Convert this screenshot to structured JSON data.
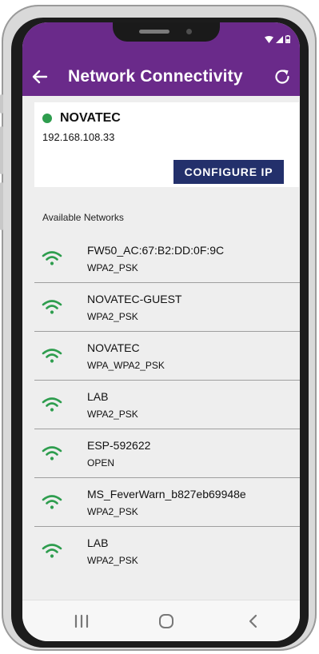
{
  "app_bar": {
    "title": "Network Connectivity",
    "back_icon": "arrow-left-icon",
    "refresh_icon": "refresh-icon",
    "background": "#6a2a8a"
  },
  "connected": {
    "ssid": "NOVATEC",
    "ip": "192.168.108.33",
    "status_color": "#2e9d4e",
    "configure_label": "CONFIGURE IP",
    "button_color": "#23306b"
  },
  "networks_label": "Available Networks",
  "networks": [
    {
      "ssid": "FW50_AC:67:B2:DD:0F:9C",
      "security": "WPA2_PSK"
    },
    {
      "ssid": "NOVATEC-GUEST",
      "security": "WPA2_PSK"
    },
    {
      "ssid": "NOVATEC",
      "security": "WPA_WPA2_PSK"
    },
    {
      "ssid": "LAB",
      "security": "WPA2_PSK"
    },
    {
      "ssid": "ESP-592622",
      "security": "OPEN"
    },
    {
      "ssid": "MS_FeverWarn_b827eb69948e",
      "security": "WPA2_PSK"
    },
    {
      "ssid": "LAB",
      "security": "WPA2_PSK"
    }
  ],
  "icons": {
    "wifi": "wifi-icon",
    "wifi_color": "#2e9d4e"
  },
  "nav": {
    "recents": "recents-icon",
    "home": "home-icon",
    "back": "back-icon"
  }
}
